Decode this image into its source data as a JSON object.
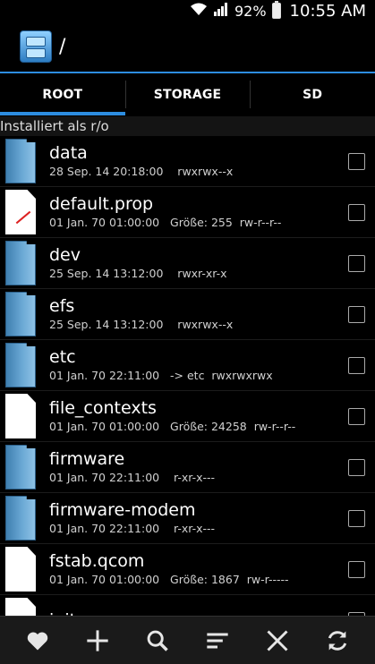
{
  "status_bar": {
    "battery": "92%",
    "time": "10:55 AM"
  },
  "action_bar": {
    "path": "/"
  },
  "tabs": [
    {
      "label": "ROOT",
      "active": true
    },
    {
      "label": "STORAGE",
      "active": false
    },
    {
      "label": "SD",
      "active": false
    }
  ],
  "mount_status": "Installiert als r/o",
  "files": [
    {
      "name": "data",
      "meta": "28 Sep. 14 20:18:00    rwxrwx--x",
      "icon": "folder-icon"
    },
    {
      "name": "default.prop",
      "meta": "01 Jan. 70 01:00:00   Größe: 255  rw-r--r--",
      "icon": "prop-file-icon"
    },
    {
      "name": "dev",
      "meta": "25 Sep. 14 13:12:00    rwxr-xr-x",
      "icon": "folder-icon"
    },
    {
      "name": "efs",
      "meta": "25 Sep. 14 13:12:00    rwxrwx--x",
      "icon": "folder-icon"
    },
    {
      "name": "etc",
      "meta": "01 Jan. 70 22:11:00   -> etc  rwxrwxrwx",
      "icon": "folder-icon"
    },
    {
      "name": "file_contexts",
      "meta": "01 Jan. 70 01:00:00   Größe: 24258  rw-r--r--",
      "icon": "file-icon"
    },
    {
      "name": "firmware",
      "meta": "01 Jan. 70 22:11:00    r-xr-x---",
      "icon": "folder-icon"
    },
    {
      "name": "firmware-modem",
      "meta": "01 Jan. 70 22:11:00    r-xr-x---",
      "icon": "folder-icon"
    },
    {
      "name": "fstab.qcom",
      "meta": "01 Jan. 70 01:00:00   Größe: 1867  rw-r-----",
      "icon": "file-icon"
    },
    {
      "name": "init",
      "meta": "",
      "icon": "file-icon"
    }
  ],
  "bottom_bar": [
    "favorite-icon",
    "add-icon",
    "search-icon",
    "sort-icon",
    "close-icon",
    "refresh-icon"
  ],
  "colors": {
    "accent": "#2d8de0",
    "background": "#000000",
    "list_row": "#000000"
  }
}
